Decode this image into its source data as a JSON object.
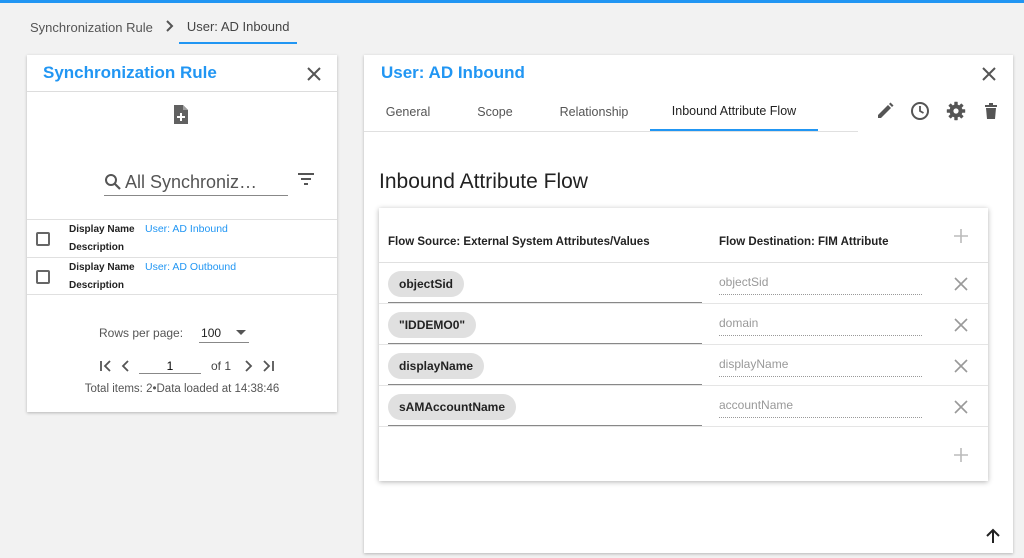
{
  "breadcrumb": {
    "items": [
      {
        "label": "Synchronization Rule"
      },
      {
        "label": "User: AD Inbound"
      }
    ]
  },
  "left_panel": {
    "title": "Synchronization Rule",
    "search": {
      "placeholder": "All Synchroniz…",
      "value": ""
    },
    "rows": [
      {
        "display_name_label": "Display Name",
        "display_name_value": "User: AD Inbound",
        "description_label": "Description"
      },
      {
        "display_name_label": "Display Name",
        "display_name_value": "User: AD Outbound",
        "description_label": "Description"
      }
    ],
    "pager": {
      "rows_per_page_label": "Rows per page:",
      "rows_per_page_value": "100",
      "page_value": "1",
      "of_label": "of 1",
      "total_line": "Total items: 2•Data loaded at 14:38:46"
    }
  },
  "right_panel": {
    "title": "User: AD Inbound",
    "tabs": [
      {
        "label": "General"
      },
      {
        "label": "Scope"
      },
      {
        "label": "Relationship"
      },
      {
        "label": "Inbound Attribute Flow"
      }
    ],
    "section_title": "Inbound Attribute Flow",
    "flow": {
      "source_header": "Flow Source: External System Attributes/Values",
      "dest_header": "Flow Destination: FIM Attribute",
      "rows": [
        {
          "source": "objectSid",
          "destination": "objectSid"
        },
        {
          "source": "\"IDDEMO0\"",
          "destination": "domain"
        },
        {
          "source": "displayName",
          "destination": "displayName"
        },
        {
          "source": "sAMAccountName",
          "destination": "accountName"
        }
      ]
    }
  },
  "colors": {
    "accent": "#2196f3",
    "chip": "#e0e0e0",
    "icon": "#555555"
  }
}
